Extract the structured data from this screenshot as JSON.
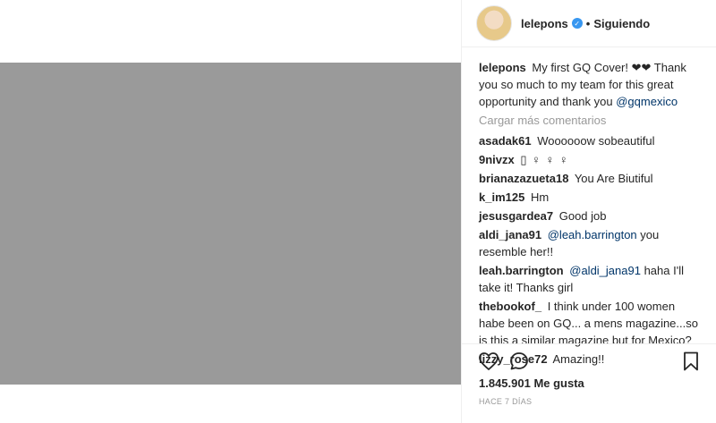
{
  "header": {
    "username": "lelepons",
    "separator": "•",
    "follow_status": "Siguiendo"
  },
  "caption": {
    "username": "lelepons",
    "text": "My first GQ Cover! ❤❤ Thank you so much to my team for this great opportunity and thank you",
    "mention": "@gqmexico"
  },
  "load_more": "Cargar más comentarios",
  "comments": [
    {
      "user": "asadak61",
      "text": "Woooooow sobeautiful"
    },
    {
      "user": "9nivzx",
      "text": "▯ ♀ ♀ ♀"
    },
    {
      "user": "brianazazueta18",
      "text": "You Are Biutiful"
    },
    {
      "user": "k_im125",
      "text": "Hm"
    },
    {
      "user": "jesusgardea7",
      "text": "Good job"
    },
    {
      "user": "aldi_jana91",
      "mention": "@leah.barrington",
      "text": "you resemble her!!"
    },
    {
      "user": "leah.barrington",
      "mention": "@aldi_jana91",
      "text": "haha I'll take it! Thanks girl"
    },
    {
      "user": "thebookof_",
      "text": "I think under 100 women habe been on GQ... a mens magazine...so is this a similar magazine but for Mexico?"
    },
    {
      "user": "lizzy_rose72",
      "text": "Amazing!!"
    }
  ],
  "likes": "1.845.901 Me gusta",
  "timestamp": "HACE 7 DÍAS",
  "icons": {
    "like": "heart-icon",
    "comment": "comment-icon",
    "save": "bookmark-icon",
    "verified": "verified-badge-icon"
  },
  "colors": {
    "mention": "#003569",
    "verified": "#3897f0",
    "muted": "#999999"
  }
}
